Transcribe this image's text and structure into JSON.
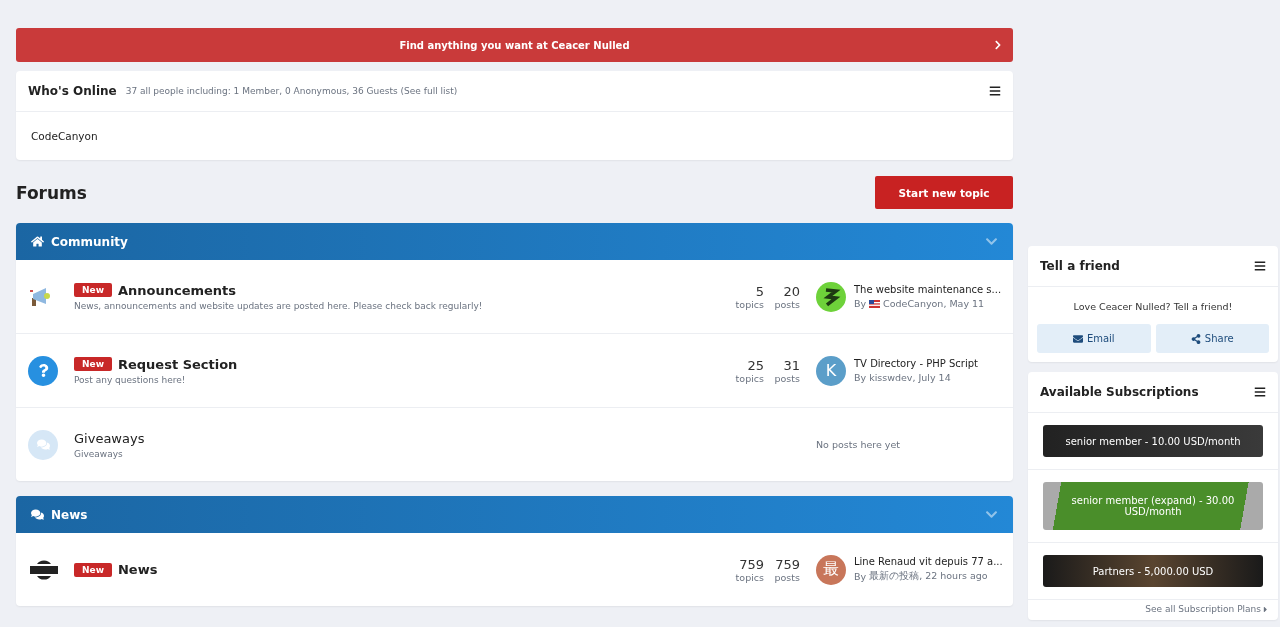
{
  "banner": {
    "text": "Find anything you want at Ceacer Nulled"
  },
  "whos_online": {
    "title": "Who's Online",
    "summary": "37 all people including: 1 Member, 0 Anonymous, 36 Guests (See full list)",
    "members": [
      "CodeCanyon"
    ]
  },
  "forums_title": "Forums",
  "new_topic_button": "Start new topic",
  "categories": [
    {
      "title": "Community",
      "kind": "home",
      "forums": [
        {
          "kind": "megaphone",
          "new_badge": "New",
          "title": "Announcements",
          "description": "News, announcements and website updates are posted here. Please check back regularly!",
          "topics": "5",
          "topics_label": "topics",
          "posts": "20",
          "posts_label": "posts",
          "last_post": {
            "title": "The website maintenance s...",
            "by": "By",
            "author": "CodeCanyon",
            "date": ", May 11",
            "kind": "image",
            "flag": true
          }
        },
        {
          "kind": "question",
          "new_badge": "New",
          "title": "Request Section",
          "description": "Post any questions here!",
          "topics": "25",
          "topics_label": "topics",
          "posts": "31",
          "posts_label": "posts",
          "last_post": {
            "title": "TV Directory - PHP Script",
            "by": "By",
            "author": "kisswdev",
            "date": ", July 14",
            "kind": "letter",
            "avatar_letter": "K",
            "color": "#5b9ec9",
            "flag": false
          }
        },
        {
          "kind": "chat",
          "title": "Giveaways",
          "description": "Giveaways",
          "empty": "No posts here yet"
        }
      ]
    },
    {
      "title": "News",
      "kind": "comments",
      "forums": [
        {
          "kind": "news",
          "new_badge": "New",
          "title": "News",
          "topics": "759",
          "topics_label": "topics",
          "posts": "759",
          "posts_label": "posts",
          "last_post": {
            "title": "Line Renaud vit depuis 77 a...",
            "by": "By",
            "author": "最新の投稿",
            "date": ", 22 hours ago",
            "kind": "letter",
            "avatar_letter": "最",
            "color": "#c8765a",
            "flag": false
          }
        }
      ]
    }
  ],
  "tell_a_friend": {
    "title": "Tell a friend",
    "text": "Love Ceacer Nulled? Tell a friend!",
    "buttons": [
      {
        "kind": "email",
        "label": "Email"
      },
      {
        "kind": "share",
        "label": "Share"
      }
    ]
  },
  "subscriptions": {
    "title": "Available Subscriptions",
    "plans": [
      {
        "kind": "dark",
        "label": "senior member - 10.00 USD/month"
      },
      {
        "kind": "green",
        "label": "senior member  (expand)  - 30.00 USD/month"
      },
      {
        "kind": "brown",
        "label": "Partners - 5,000.00 USD"
      }
    ],
    "link": "See all Subscription Plans"
  }
}
